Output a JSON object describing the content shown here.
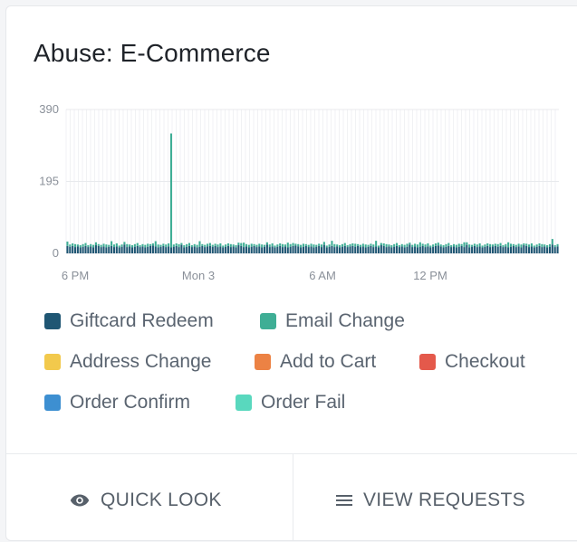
{
  "widget": {
    "title": "Abuse: E-Commerce"
  },
  "chart_data": {
    "type": "bar",
    "title": "",
    "xlabel": "",
    "ylabel": "",
    "ylim": [
      0,
      390
    ],
    "yticks": [
      "0",
      "195",
      "390"
    ],
    "xticks": [
      "6 PM",
      "Mon 3",
      "6 AM",
      "12 PM"
    ],
    "grid": true,
    "stacked": true,
    "series": [
      {
        "name": "Giftcard Redeem",
        "color": "#1f5673",
        "typical_value": 18
      },
      {
        "name": "Email Change",
        "color": "#3fae95",
        "typical_value": 6,
        "peak_value": 325
      }
    ]
  },
  "legend": {
    "items": [
      {
        "label": "Giftcard Redeem",
        "color": "#1f5673"
      },
      {
        "label": "Email Change",
        "color": "#3fae95"
      },
      {
        "label": "Address Change",
        "color": "#f2c94c"
      },
      {
        "label": "Add to Cart",
        "color": "#ec8244"
      },
      {
        "label": "Checkout",
        "color": "#e4594b"
      },
      {
        "label": "Order Confirm",
        "color": "#3d8fd1"
      },
      {
        "label": "Order Fail",
        "color": "#59d8be"
      }
    ]
  },
  "actions": {
    "quick_look": "QUICK LOOK",
    "view_requests": "VIEW REQUESTS"
  }
}
